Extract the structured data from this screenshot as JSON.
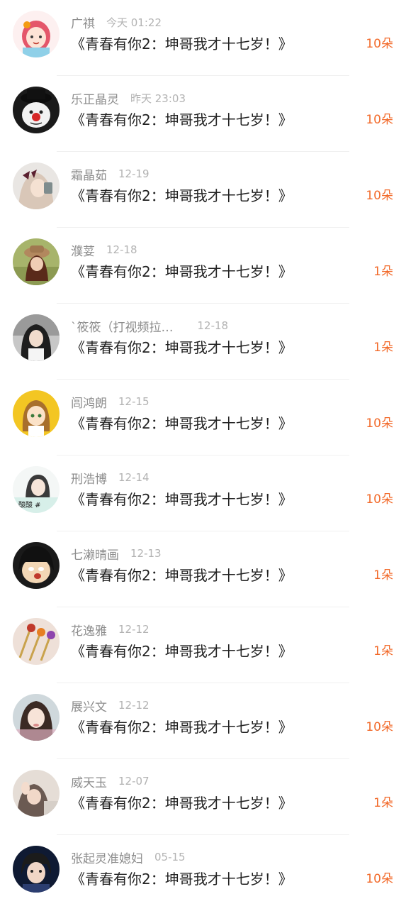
{
  "colors": {
    "accent": "#f26a2a",
    "name": "#8c8c8c",
    "time": "#b3b3b3",
    "title": "#222222"
  },
  "items": [
    {
      "name": "广祺",
      "time": "今天 01:22",
      "title": "《青春有你2：坤哥我才十七岁！》",
      "gift": "10朵",
      "avatar": "cartoon-girl-avatar"
    },
    {
      "name": "乐正晶灵",
      "time": "昨天 23:03",
      "title": "《青春有你2：坤哥我才十七岁！》",
      "gift": "10朵",
      "avatar": "clown-avatar"
    },
    {
      "name": "霜晶茹",
      "time": "12-19",
      "title": "《青春有你2：坤哥我才十七岁！》",
      "gift": "10朵",
      "avatar": "girl-bow-avatar"
    },
    {
      "name": "濮荽",
      "time": "12-18",
      "title": "《青春有你2：坤哥我才十七岁！》",
      "gift": "1朵",
      "avatar": "girl-hat-avatar"
    },
    {
      "name": "`筱筱（打视频拉…",
      "time": "12-18",
      "title": "《青春有你2：坤哥我才十七岁！》",
      "gift": "1朵",
      "avatar": "girl-dark-hair-avatar"
    },
    {
      "name": "闾鸿朗",
      "time": "12-15",
      "title": "《青春有你2：坤哥我才十七岁！》",
      "gift": "10朵",
      "avatar": "anime-girl-avatar"
    },
    {
      "name": "刑浩博",
      "time": "12-14",
      "title": "《青春有你2：坤哥我才十七岁！》",
      "gift": "10朵",
      "avatar": "photo-sticker-avatar",
      "avatar_text": "酸酸 #"
    },
    {
      "name": "七濑晴画",
      "time": "12-13",
      "title": "《青春有你2：坤哥我才十七岁！》",
      "gift": "1朵",
      "avatar": "crying-cartoon-avatar"
    },
    {
      "name": "花逸雅",
      "time": "12-12",
      "title": "《青春有你2：坤哥我才十七岁！》",
      "gift": "1朵",
      "avatar": "hair-clips-avatar"
    },
    {
      "name": "展兴文",
      "time": "12-12",
      "title": "《青春有你2：坤哥我才十七岁！》",
      "gift": "10朵",
      "avatar": "girl-portrait-avatar"
    },
    {
      "name": "威天玉",
      "time": "12-07",
      "title": "《青春有你2：坤哥我才十七岁！》",
      "gift": "1朵",
      "avatar": "hand-pose-avatar"
    },
    {
      "name": "张起灵准媳妇",
      "time": "05-15",
      "title": "《青春有你2：坤哥我才十七岁！》",
      "gift": "10朵",
      "avatar": "boy-portrait-avatar"
    }
  ]
}
